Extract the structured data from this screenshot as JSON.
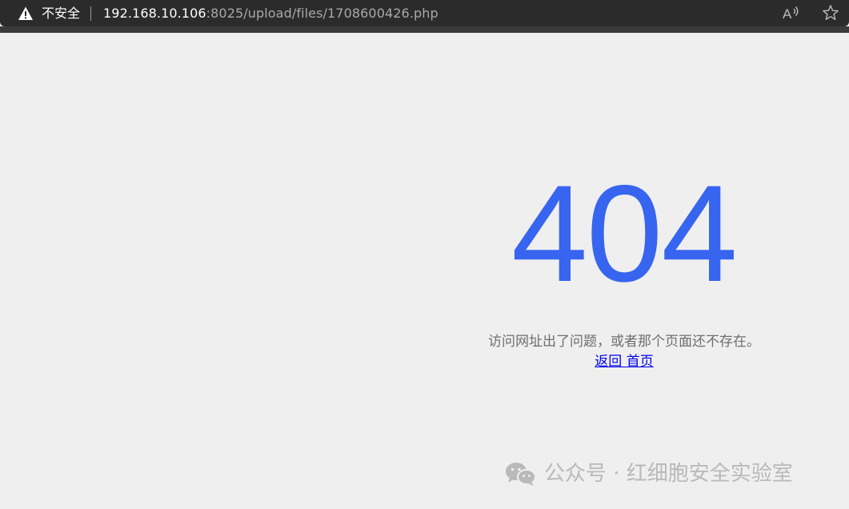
{
  "browser": {
    "security_label": "不安全",
    "url_host": "192.168.10.106",
    "url_rest": ":8025/upload/files/1708600426.php",
    "icons": {
      "warning": "warning-triangle-icon",
      "read_aloud": "read-aloud-icon",
      "favorite": "star-icon"
    }
  },
  "page": {
    "error_code": "404",
    "message": "访问网址出了问题，或者那个页面还不存在。",
    "back_link": "返回 首页",
    "accent_color": "#3765f0"
  },
  "watermark": {
    "text": "公众号 · 红细胞安全实验室",
    "icon": "wechat-icon"
  }
}
